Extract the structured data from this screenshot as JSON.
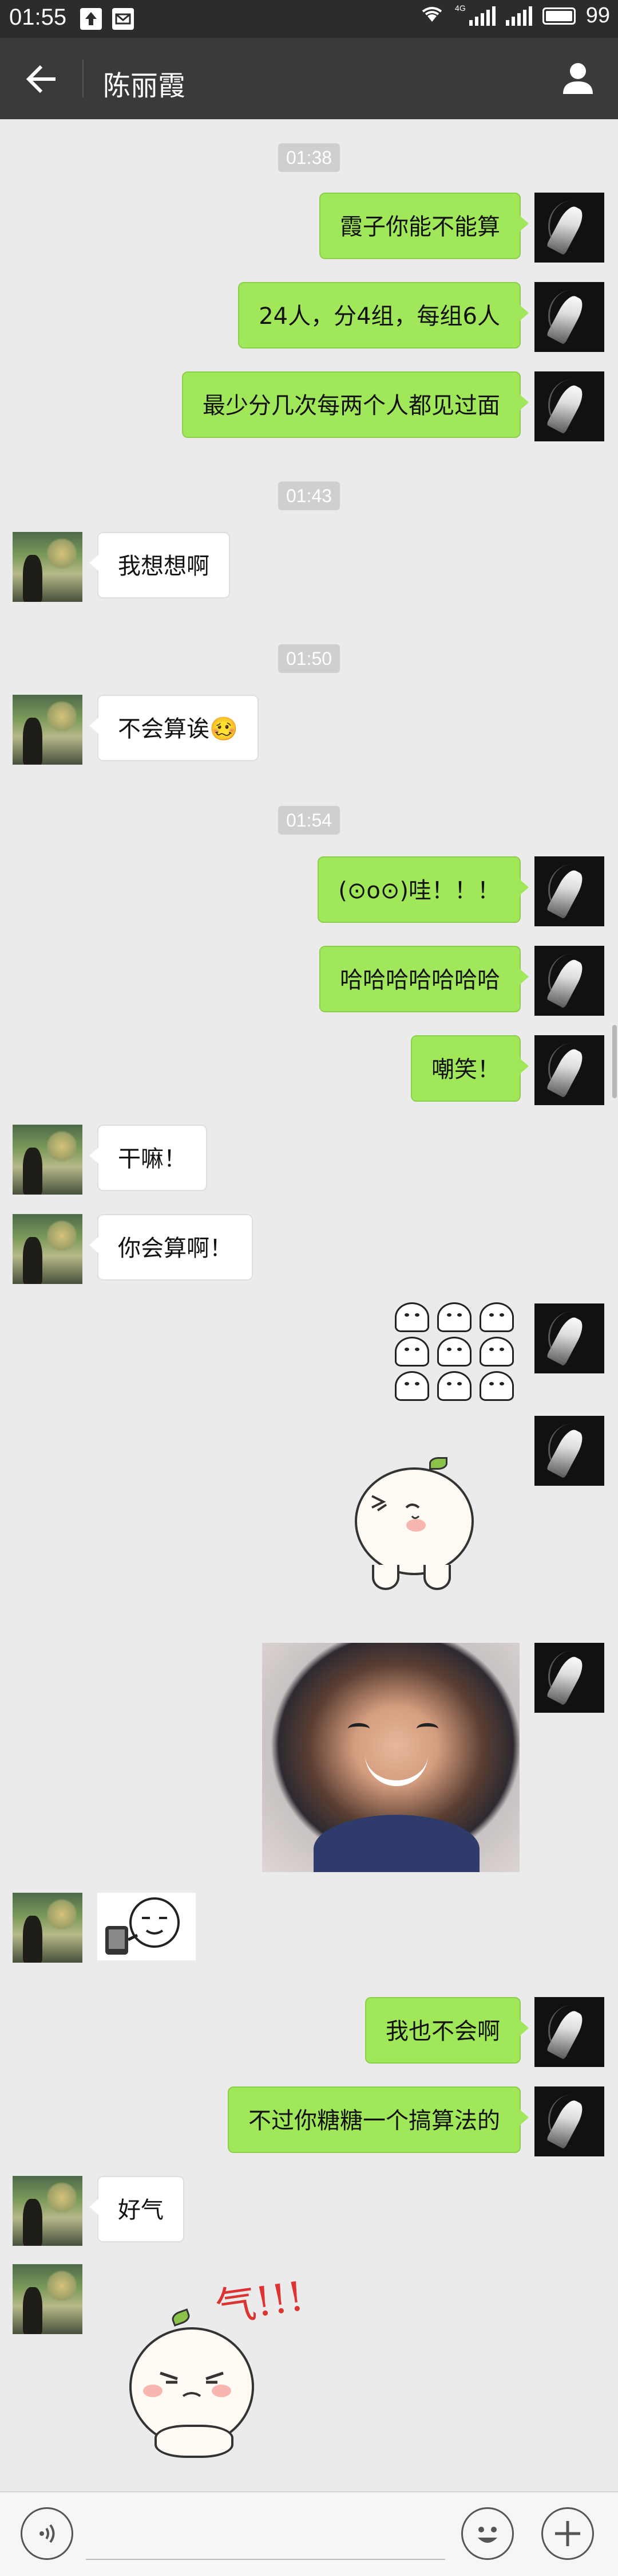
{
  "status_bar": {
    "time": "01:55",
    "network_tag": "4G",
    "battery_level": "99",
    "icons": [
      "upload-icon",
      "mail-icon",
      "wifi-icon",
      "signal-icon",
      "battery-icon"
    ]
  },
  "header": {
    "title": "陈丽霞",
    "back_icon": "arrow-left-icon",
    "profile_icon": "person-icon"
  },
  "conversation": {
    "timestamps": [
      "01:38",
      "01:43",
      "01:50",
      "01:54"
    ],
    "messages": [
      {
        "from": "me",
        "type": "text",
        "text": "霞子你能不能算"
      },
      {
        "from": "me",
        "type": "text",
        "text": "24人，分4组，每组6人"
      },
      {
        "from": "me",
        "type": "text",
        "text": "最少分几次每两个人都见过面"
      },
      {
        "from": "other",
        "type": "text",
        "text": "我想想啊"
      },
      {
        "from": "other",
        "type": "text",
        "text": "不会算诶🥴"
      },
      {
        "from": "me",
        "type": "text",
        "text": "(⊙o⊙)哇！！！"
      },
      {
        "from": "me",
        "type": "text",
        "text": "哈哈哈哈哈哈哈"
      },
      {
        "from": "me",
        "type": "text",
        "text": "嘲笑！"
      },
      {
        "from": "other",
        "type": "text",
        "text": "干嘛！"
      },
      {
        "from": "other",
        "type": "text",
        "text": "你会算啊！"
      },
      {
        "from": "me",
        "type": "sticker",
        "sticker": "ghost-faces-sticker"
      },
      {
        "from": "me",
        "type": "sticker",
        "sticker": "bun-wink-sticker"
      },
      {
        "from": "me",
        "type": "image",
        "sticker": "laughing-child-photo"
      },
      {
        "from": "other",
        "type": "sticker",
        "sticker": "phone-face-sticker"
      },
      {
        "from": "me",
        "type": "text",
        "text": "我也不会啊"
      },
      {
        "from": "me",
        "type": "text",
        "text": "不过你糖糖一个搞算法的"
      },
      {
        "from": "other",
        "type": "text",
        "text": "好气"
      },
      {
        "from": "other",
        "type": "sticker",
        "sticker": "angry-bun-sticker",
        "caption": "气!!!"
      }
    ]
  },
  "input_bar": {
    "voice_icon": "voice-icon",
    "emoji_icon": "emoji-icon",
    "plus_icon": "plus-icon",
    "input_value": "",
    "input_placeholder": ""
  },
  "colors": {
    "my_bubble": "#a0e75a",
    "other_bubble": "#ffffff",
    "background": "#ebebeb",
    "title_bar": "#3a3a3a"
  }
}
